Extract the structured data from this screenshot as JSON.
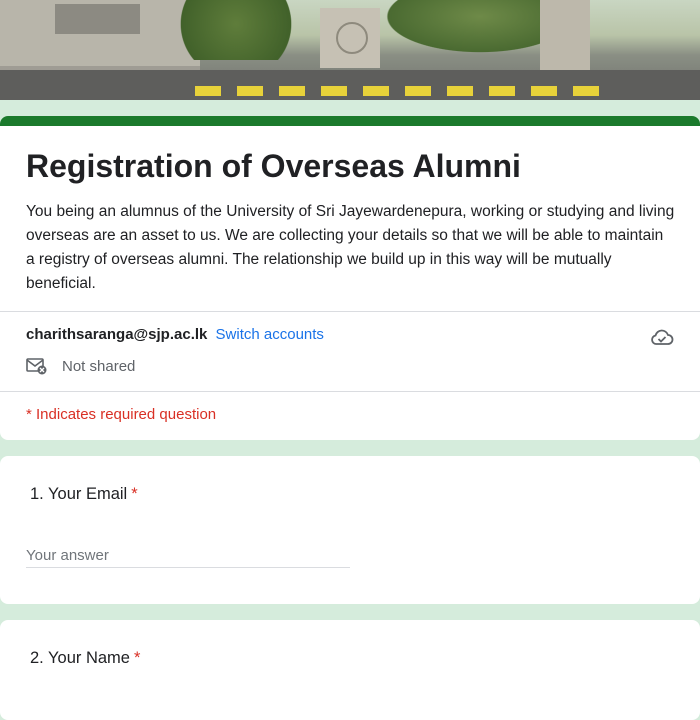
{
  "form": {
    "title": "Registration of Overseas Alumni",
    "description": "You being an alumnus of the University of Sri Jayewardenepura, working or studying and living overseas are an asset to us.  We are collecting your details so that we will be able to maintain a registry of overseas alumni. The relationship we build up in this way will be mutually beneficial.",
    "account_email": "charithsaranga@sjp.ac.lk",
    "switch_accounts": "Switch accounts",
    "not_shared": "Not shared",
    "required_note": "* Indicates required question",
    "accent_color": "#1b7a2c"
  },
  "questions": [
    {
      "label": "1. Your Email",
      "required_mark": "*",
      "placeholder": "Your answer"
    },
    {
      "label": "2. Your Name",
      "required_mark": "*"
    }
  ],
  "icons": {
    "cloud": "cloud-check-icon",
    "not_shared": "mail-x-icon"
  }
}
